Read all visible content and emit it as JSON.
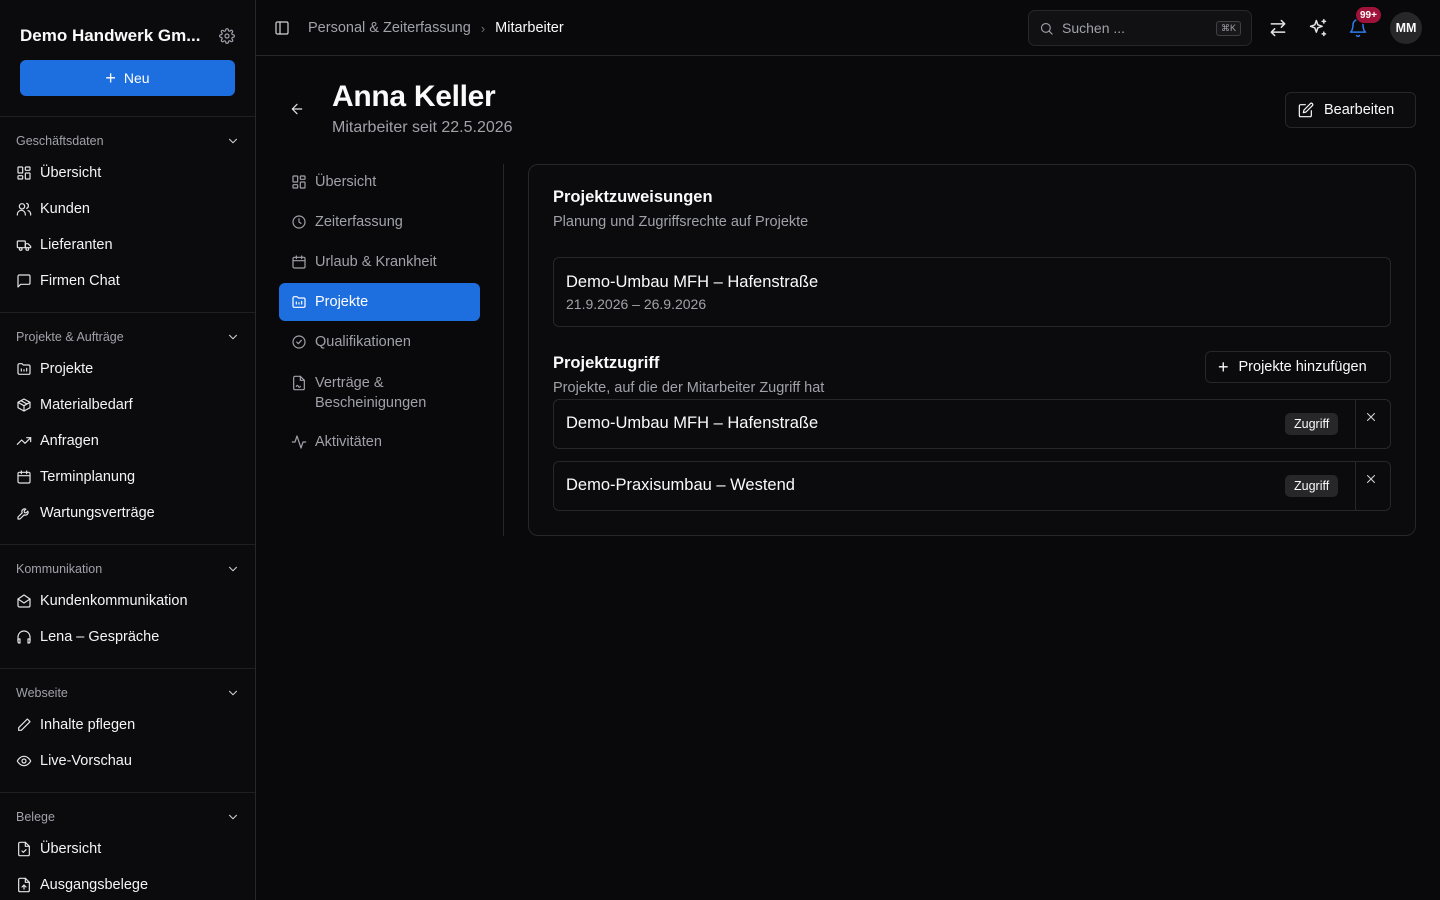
{
  "sidebar": {
    "company": "Demo Handwerk Gm...",
    "new_label": "Neu",
    "sections": [
      {
        "title": "Geschäftsdaten",
        "items": [
          {
            "label": "Übersicht",
            "icon": "dashboard-icon"
          },
          {
            "label": "Kunden",
            "icon": "users-icon"
          },
          {
            "label": "Lieferanten",
            "icon": "truck-icon"
          },
          {
            "label": "Firmen Chat",
            "icon": "chat-icon"
          }
        ]
      },
      {
        "title": "Projekte & Aufträge",
        "items": [
          {
            "label": "Projekte",
            "icon": "folder-icon"
          },
          {
            "label": "Materialbedarf",
            "icon": "package-icon"
          },
          {
            "label": "Anfragen",
            "icon": "trending-up-icon"
          },
          {
            "label": "Terminplanung",
            "icon": "calendar-icon"
          },
          {
            "label": "Wartungsverträge",
            "icon": "wrench-icon"
          }
        ]
      },
      {
        "title": "Kommunikation",
        "items": [
          {
            "label": "Kundenkommunikation",
            "icon": "mail-open-icon"
          },
          {
            "label": "Lena – Gespräche",
            "icon": "headphones-icon"
          }
        ]
      },
      {
        "title": "Webseite",
        "items": [
          {
            "label": "Inhalte pflegen",
            "icon": "pen-icon"
          },
          {
            "label": "Live-Vorschau",
            "icon": "eye-icon"
          }
        ]
      },
      {
        "title": "Belege",
        "items": [
          {
            "label": "Übersicht",
            "icon": "file-check-icon"
          },
          {
            "label": "Ausgangsbelege",
            "icon": "file-out-icon"
          }
        ]
      }
    ]
  },
  "topbar": {
    "breadcrumb": [
      "Personal & Zeiterfassung",
      "Mitarbeiter"
    ],
    "search_placeholder": "Suchen ...",
    "search_shortcut": "⌘K",
    "notifications": "99+",
    "avatar_initials": "MM"
  },
  "header": {
    "name": "Anna Keller",
    "subtitle": "Mitarbeiter seit 22.5.2026",
    "edit_label": "Bearbeiten"
  },
  "subnav": [
    {
      "label": "Übersicht",
      "icon": "dashboard-icon",
      "active": false
    },
    {
      "label": "Zeiterfassung",
      "icon": "clock-icon",
      "active": false
    },
    {
      "label": "Urlaub & Krankheit",
      "icon": "calendar-icon",
      "active": false
    },
    {
      "label": "Projekte",
      "icon": "folder-icon",
      "active": true
    },
    {
      "label": "Qualifikationen",
      "icon": "check-circle-icon",
      "active": false
    },
    {
      "label": "Verträge &\nBescheinigungen",
      "icon": "file-contract-icon",
      "active": false
    },
    {
      "label": "Aktivitäten",
      "icon": "activity-icon",
      "active": false
    }
  ],
  "assignments": {
    "title": "Projektzuweisungen",
    "description": "Planung und Zugriffsrechte auf Projekte",
    "items": [
      {
        "name": "Demo-Umbau MFH – Hafenstraße",
        "dates": "21.9.2026 – 26.9.2026"
      }
    ]
  },
  "access": {
    "title": "Projektzugriff",
    "description": "Projekte, auf die der Mitarbeiter Zugriff hat",
    "add_label": "Projekte hinzufügen",
    "items": [
      {
        "name": "Demo-Umbau MFH – Hafenstraße",
        "badge": "Zugriff"
      },
      {
        "name": "Demo-Praxisumbau – Westend",
        "badge": "Zugriff"
      }
    ]
  },
  "colors": {
    "accent": "#1d6fe0",
    "background": "#09090b",
    "badge": "#9f1239"
  }
}
